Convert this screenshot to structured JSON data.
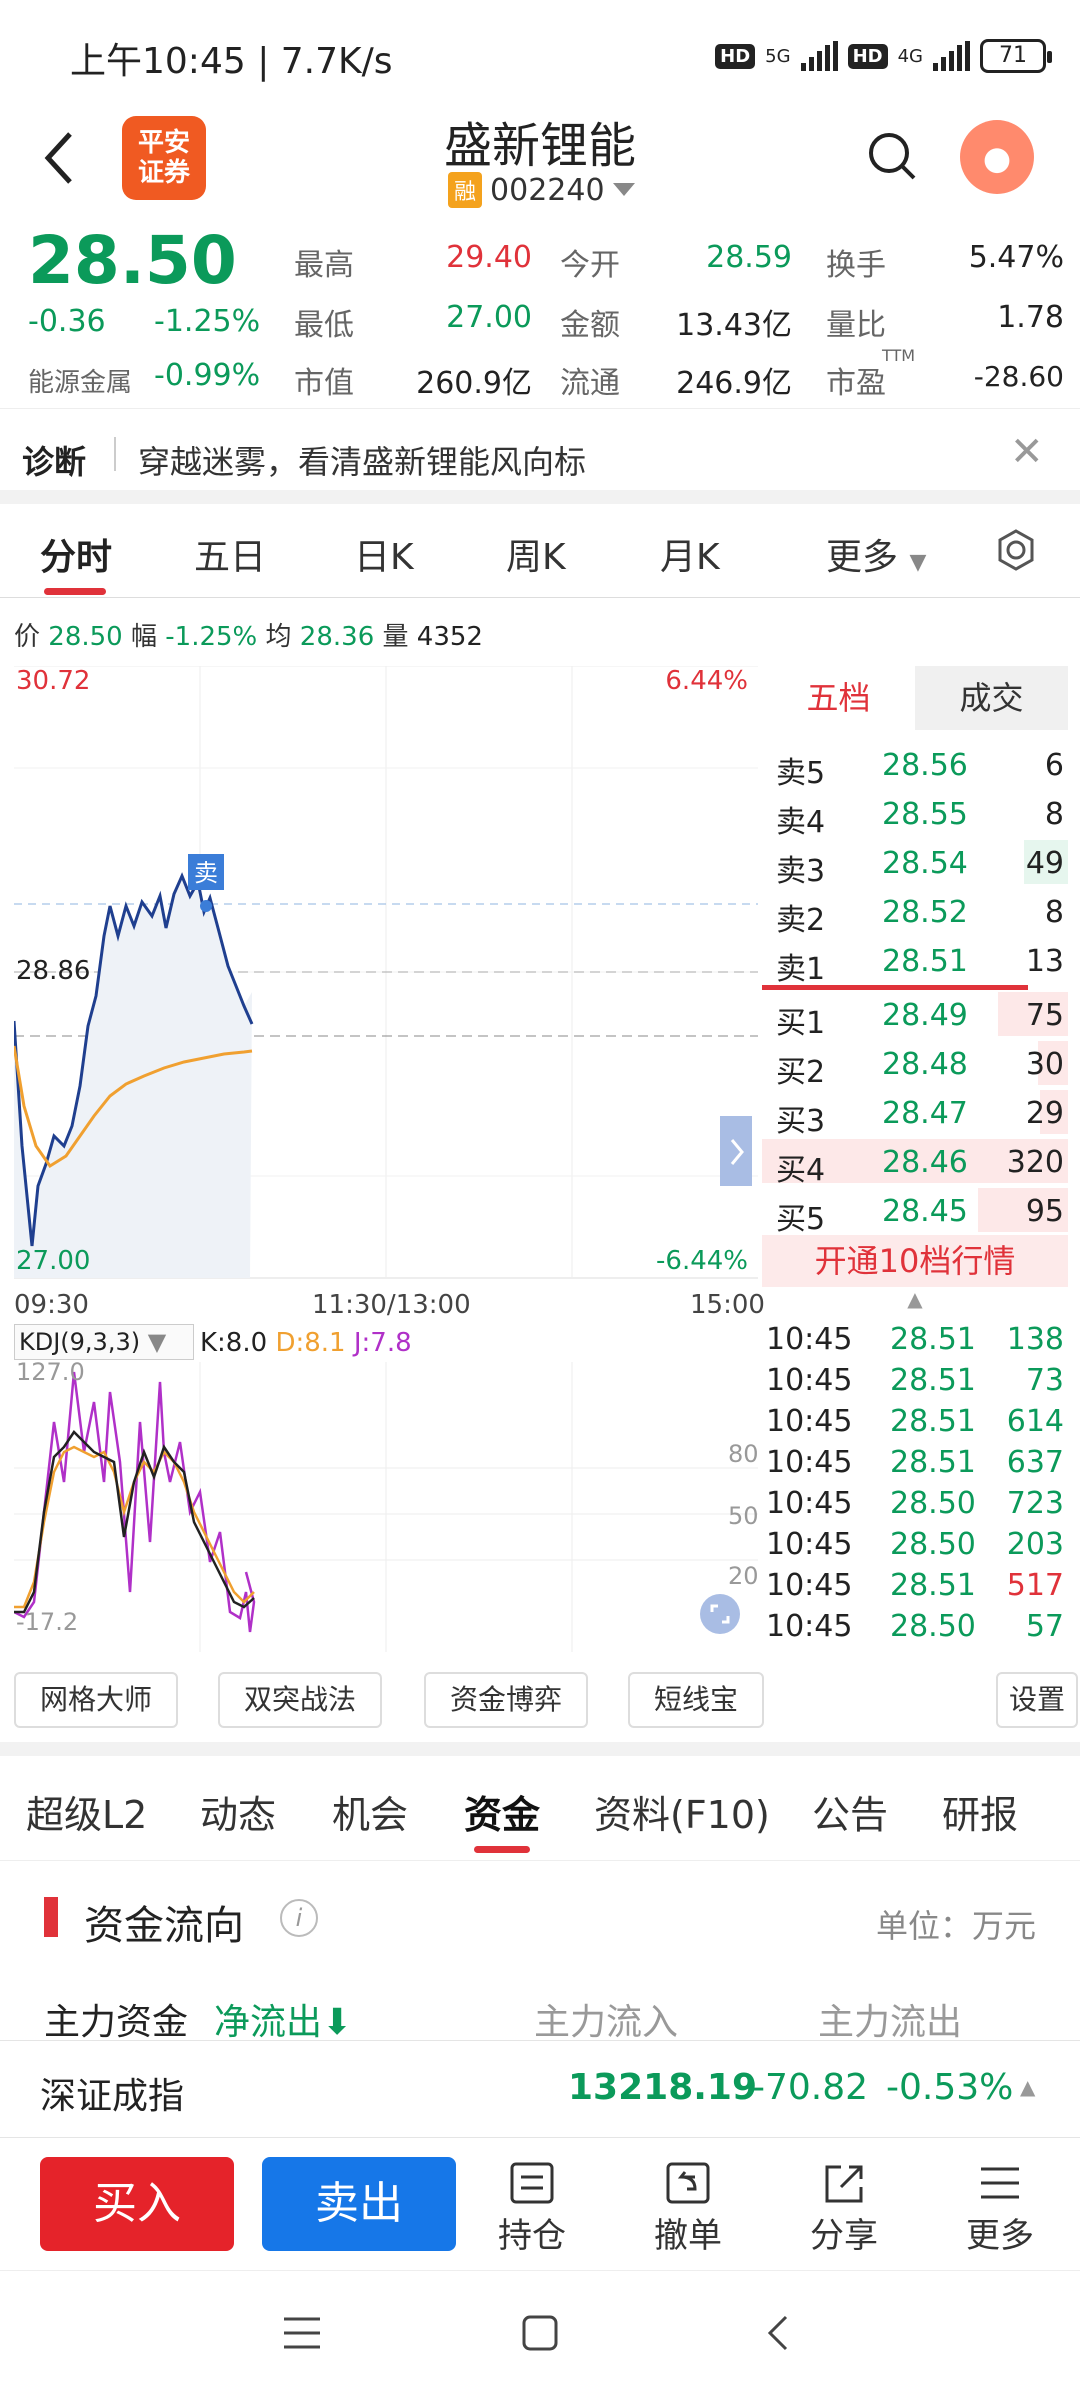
{
  "status": {
    "time": "上午10:45 | 7.7K/s",
    "net1": "5G",
    "net2": "4G",
    "battery": "71"
  },
  "header": {
    "logo": "平安证券",
    "title": "盛新锂能",
    "badge": "融",
    "code": "002240"
  },
  "quote": {
    "price": "28.50",
    "change": "-0.36",
    "change_pct": "-1.25%",
    "sector": "能源金属",
    "sector_pct": "-0.99%",
    "high_label": "最高",
    "high": "29.40",
    "open_label": "今开",
    "open": "28.59",
    "turnover_label": "换手",
    "turnover": "5.47%",
    "low_label": "最低",
    "low": "27.00",
    "amount_label": "金额",
    "amount": "13.43亿",
    "volratio_label": "量比",
    "volratio": "1.78",
    "mcap_label": "市值",
    "mcap": "260.9亿",
    "float_label": "流通",
    "float": "246.9亿",
    "pe_label": "市盈",
    "pe_sup": "TTM",
    "pe": "-28.60"
  },
  "diagnosis": {
    "label": "诊断",
    "text": "穿越迷雾，看清盛新锂能风向标"
  },
  "ktabs": [
    "分时",
    "五日",
    "日K",
    "周K",
    "月K",
    "更多"
  ],
  "infoline": {
    "p_label": "价",
    "p": "28.50",
    "f_label": "幅",
    "f": "-1.25%",
    "a_label": "均",
    "a": "28.36",
    "v_label": "量",
    "v": "4352"
  },
  "chart": {
    "ymax": "30.72",
    "ymax_pct": "6.44%",
    "ymid": "28.86",
    "ymin": "27.00",
    "ymin_pct": "-6.44%",
    "t_start": "09:30",
    "t_mid": "11:30/13:00",
    "t_end": "15:00",
    "sell_marker": "卖"
  },
  "kdj": {
    "label": "KDJ(9,3,3)",
    "k": "K:8.0",
    "d": "D:8.1",
    "j": "J:7.8",
    "top": "127.0",
    "bottom": "-17.2",
    "l80": "80",
    "l50": "50",
    "l20": "20"
  },
  "book": {
    "tab1": "五档",
    "tab2": "成交",
    "asks": [
      {
        "label": "卖5",
        "price": "28.56",
        "vol": "6"
      },
      {
        "label": "卖4",
        "price": "28.55",
        "vol": "8"
      },
      {
        "label": "卖3",
        "price": "28.54",
        "vol": "49"
      },
      {
        "label": "卖2",
        "price": "28.52",
        "vol": "8"
      },
      {
        "label": "卖1",
        "price": "28.51",
        "vol": "13"
      }
    ],
    "bids": [
      {
        "label": "买1",
        "price": "28.49",
        "vol": "75"
      },
      {
        "label": "买2",
        "price": "28.48",
        "vol": "30"
      },
      {
        "label": "买3",
        "price": "28.47",
        "vol": "29"
      },
      {
        "label": "买4",
        "price": "28.46",
        "vol": "320"
      },
      {
        "label": "买5",
        "price": "28.45",
        "vol": "95"
      }
    ],
    "open10": "开通10档行情"
  },
  "ticks": [
    {
      "t": "10:45",
      "p": "28.51",
      "v": "138"
    },
    {
      "t": "10:45",
      "p": "28.51",
      "v": "73"
    },
    {
      "t": "10:45",
      "p": "28.51",
      "v": "614"
    },
    {
      "t": "10:45",
      "p": "28.51",
      "v": "637"
    },
    {
      "t": "10:45",
      "p": "28.50",
      "v": "723"
    },
    {
      "t": "10:45",
      "p": "28.50",
      "v": "203"
    },
    {
      "t": "10:45",
      "p": "28.51",
      "v": "517"
    },
    {
      "t": "10:45",
      "p": "28.50",
      "v": "57"
    }
  ],
  "tools": [
    "网格大师",
    "双突战法",
    "资金博弈",
    "短线宝",
    "设置"
  ],
  "btabs": [
    "超级L2",
    "动态",
    "机会",
    "资金",
    "资料(F10)",
    "公告",
    "研报"
  ],
  "fund": {
    "title": "资金流向",
    "unit": "单位：万元",
    "main": "主力资金",
    "net": "净流出",
    "in": "主力流入",
    "out": "主力流出"
  },
  "index": {
    "name": "深证成指",
    "value": "13218.19",
    "change": "-70.82",
    "pct": "-0.53%"
  },
  "actions": {
    "buy": "买入",
    "sell": "卖出",
    "hold": "持仓",
    "cancel": "撤单",
    "share": "分享",
    "more": "更多"
  },
  "colors": {
    "up": "#e0323a",
    "down": "#0b9a5a",
    "buy": "#e5232a",
    "sell": "#1677e8",
    "price_line": "#1f3f8f",
    "avg_line": "#f0a030"
  }
}
